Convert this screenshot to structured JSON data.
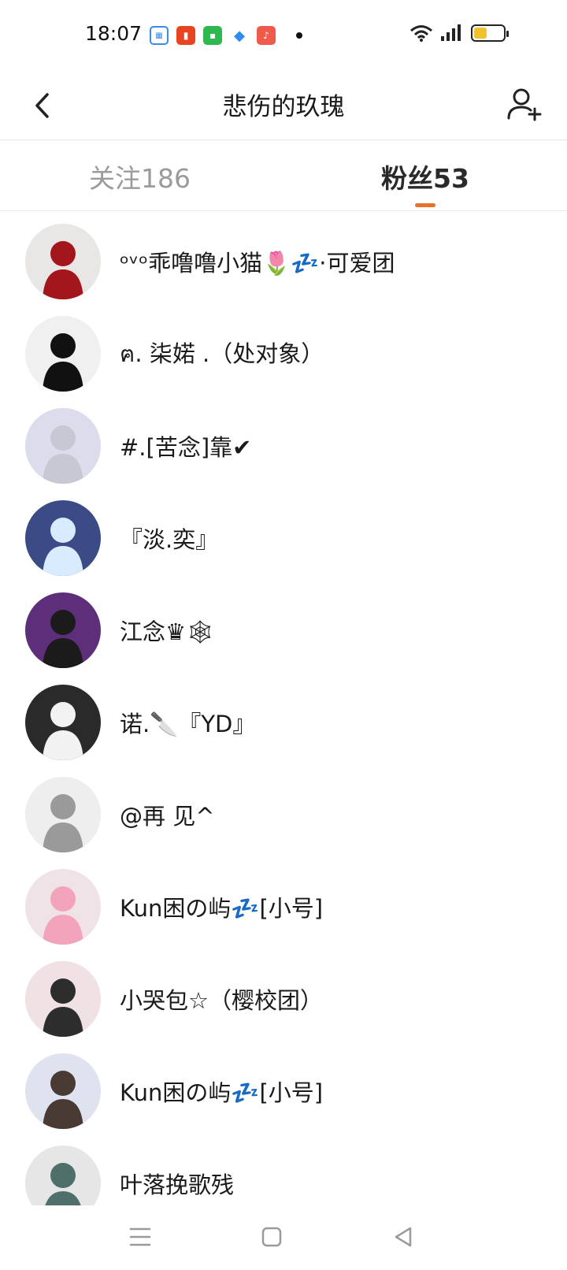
{
  "status_bar": {
    "time": "18:07",
    "notifications": [
      "calendar-icon",
      "listen-icon",
      "app-store-icon",
      "feather-icon",
      "music-icon"
    ],
    "system_icons": [
      "wifi-icon",
      "signal-icon",
      "battery-icon"
    ],
    "battery_level": 0.45,
    "battery_color": "#f2c12e"
  },
  "header": {
    "title": "悲伤的玖瑰",
    "back_icon": "chevron-left-icon",
    "action_icon": "add-user-icon"
  },
  "tabs": [
    {
      "label": "关注186",
      "active": false
    },
    {
      "label": "粉丝53",
      "active": true
    }
  ],
  "accent_color": "#e8722c",
  "followers": [
    {
      "name": "ᵒᵛᵒ乖噜噜小猫🌷💤·可爱团",
      "avatar_bg": "#e9e6e6",
      "avatar_fg": "#a3161c"
    },
    {
      "name": "ฅ. 柒婼 .（处对象）",
      "avatar_bg": "#f0f0f0",
      "avatar_fg": "#111111"
    },
    {
      "name": "#.[苦念]靠✔",
      "avatar_bg": "#dcdcec",
      "avatar_fg": "#c8c8d4"
    },
    {
      "name": "『淡.奕』",
      "avatar_bg": "#3a4b86",
      "avatar_fg": "#d9ecff"
    },
    {
      "name": "江念♛🕸",
      "avatar_bg": "#5d2e7a",
      "avatar_fg": "#1b1b1b"
    },
    {
      "name": "诺.🔪『YD』",
      "avatar_bg": "#2a2a2a",
      "avatar_fg": "#f2f2f2"
    },
    {
      "name": "@再   见^",
      "avatar_bg": "#eeeeee",
      "avatar_fg": "#9a9a9a"
    },
    {
      "name": "Kun困の屿💤[小号]",
      "avatar_bg": "#efe3e8",
      "avatar_fg": "#f3a4bd"
    },
    {
      "name": "小哭包☆（樱校团）",
      "avatar_bg": "#efe1e4",
      "avatar_fg": "#2d2d2d"
    },
    {
      "name": "Kun困の屿💤[小号]",
      "avatar_bg": "#dfe3ef",
      "avatar_fg": "#4a3a34"
    },
    {
      "name": "叶落挽歌残",
      "avatar_bg": "#e6e6e6",
      "avatar_fg": "#4f6f6a"
    }
  ],
  "nav_bar": {
    "buttons": [
      "menu-icon",
      "home-icon",
      "back-triangle-icon"
    ]
  }
}
